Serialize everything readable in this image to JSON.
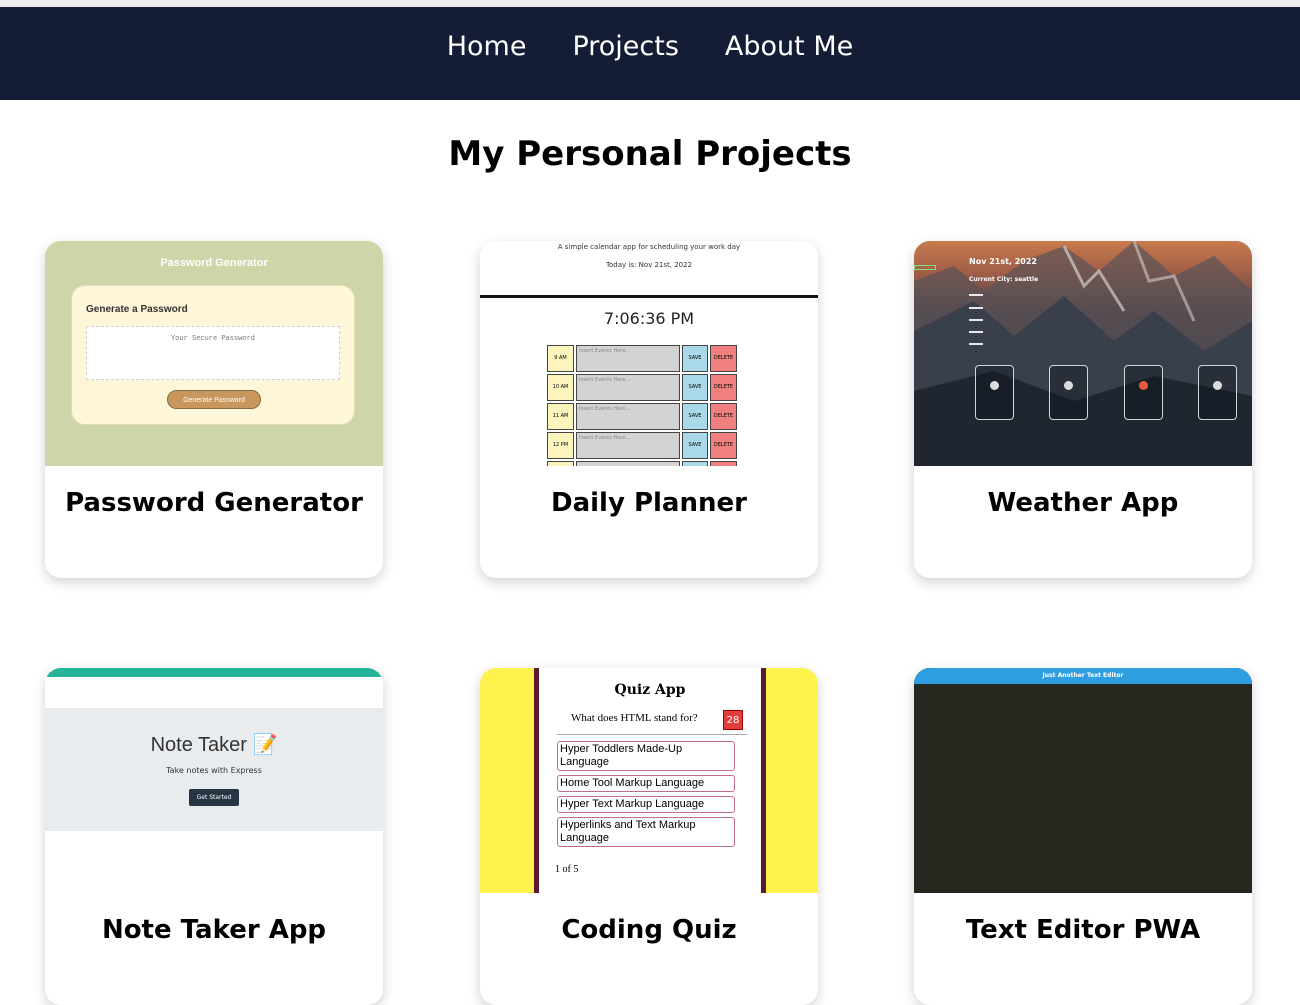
{
  "nav": {
    "items": [
      {
        "label": "Home"
      },
      {
        "label": "Projects"
      },
      {
        "label": "About Me"
      }
    ]
  },
  "page": {
    "title": "My Personal Projects"
  },
  "projects": [
    {
      "title": "Password Generator",
      "thumb": {
        "header": "Password Generator",
        "subheading": "Generate a Password",
        "placeholder": "Your Secure Password",
        "button": "Generate Password",
        "bg_color": "#cdd5a9"
      }
    },
    {
      "title": "Daily Planner",
      "thumb": {
        "tagline": "A simple calendar app for scheduling your work day",
        "today": "Today is:  Nov 21st, 2022",
        "clock": "7:06:36 PM",
        "rows": [
          {
            "hour": "9 AM",
            "placeholder": "Insert Events Here...",
            "save": "SAVE",
            "delete": "DELETE"
          },
          {
            "hour": "10 AM",
            "placeholder": "Insert Events Here...",
            "save": "SAVE",
            "delete": "DELETE"
          },
          {
            "hour": "11 AM",
            "placeholder": "Insert Events Here...",
            "save": "SAVE",
            "delete": "DELETE"
          },
          {
            "hour": "12 PM",
            "placeholder": "Insert Events Here...",
            "save": "SAVE",
            "delete": "DELETE"
          }
        ]
      }
    },
    {
      "title": "Weather App",
      "thumb": {
        "date": "Nov 21st, 2022",
        "city": "Current City: seattle"
      }
    },
    {
      "title": "Note Taker App",
      "thumb": {
        "heading": "Note Taker 📝",
        "subtitle": "Take notes with Express",
        "button": "Get Started"
      }
    },
    {
      "title": "Coding Quiz",
      "thumb": {
        "heading": "Quiz App",
        "question": "What does HTML stand for?",
        "timer": "28",
        "options": [
          "Hyper Toddlers Made-Up Language",
          "Home Tool Markup Language",
          "Hyper Text Markup Language",
          "Hyperlinks and Text Markup Language"
        ],
        "progress": "1 of 5"
      }
    },
    {
      "title": "Text Editor PWA",
      "thumb": {
        "header": "Just Another Text Editor"
      }
    }
  ]
}
